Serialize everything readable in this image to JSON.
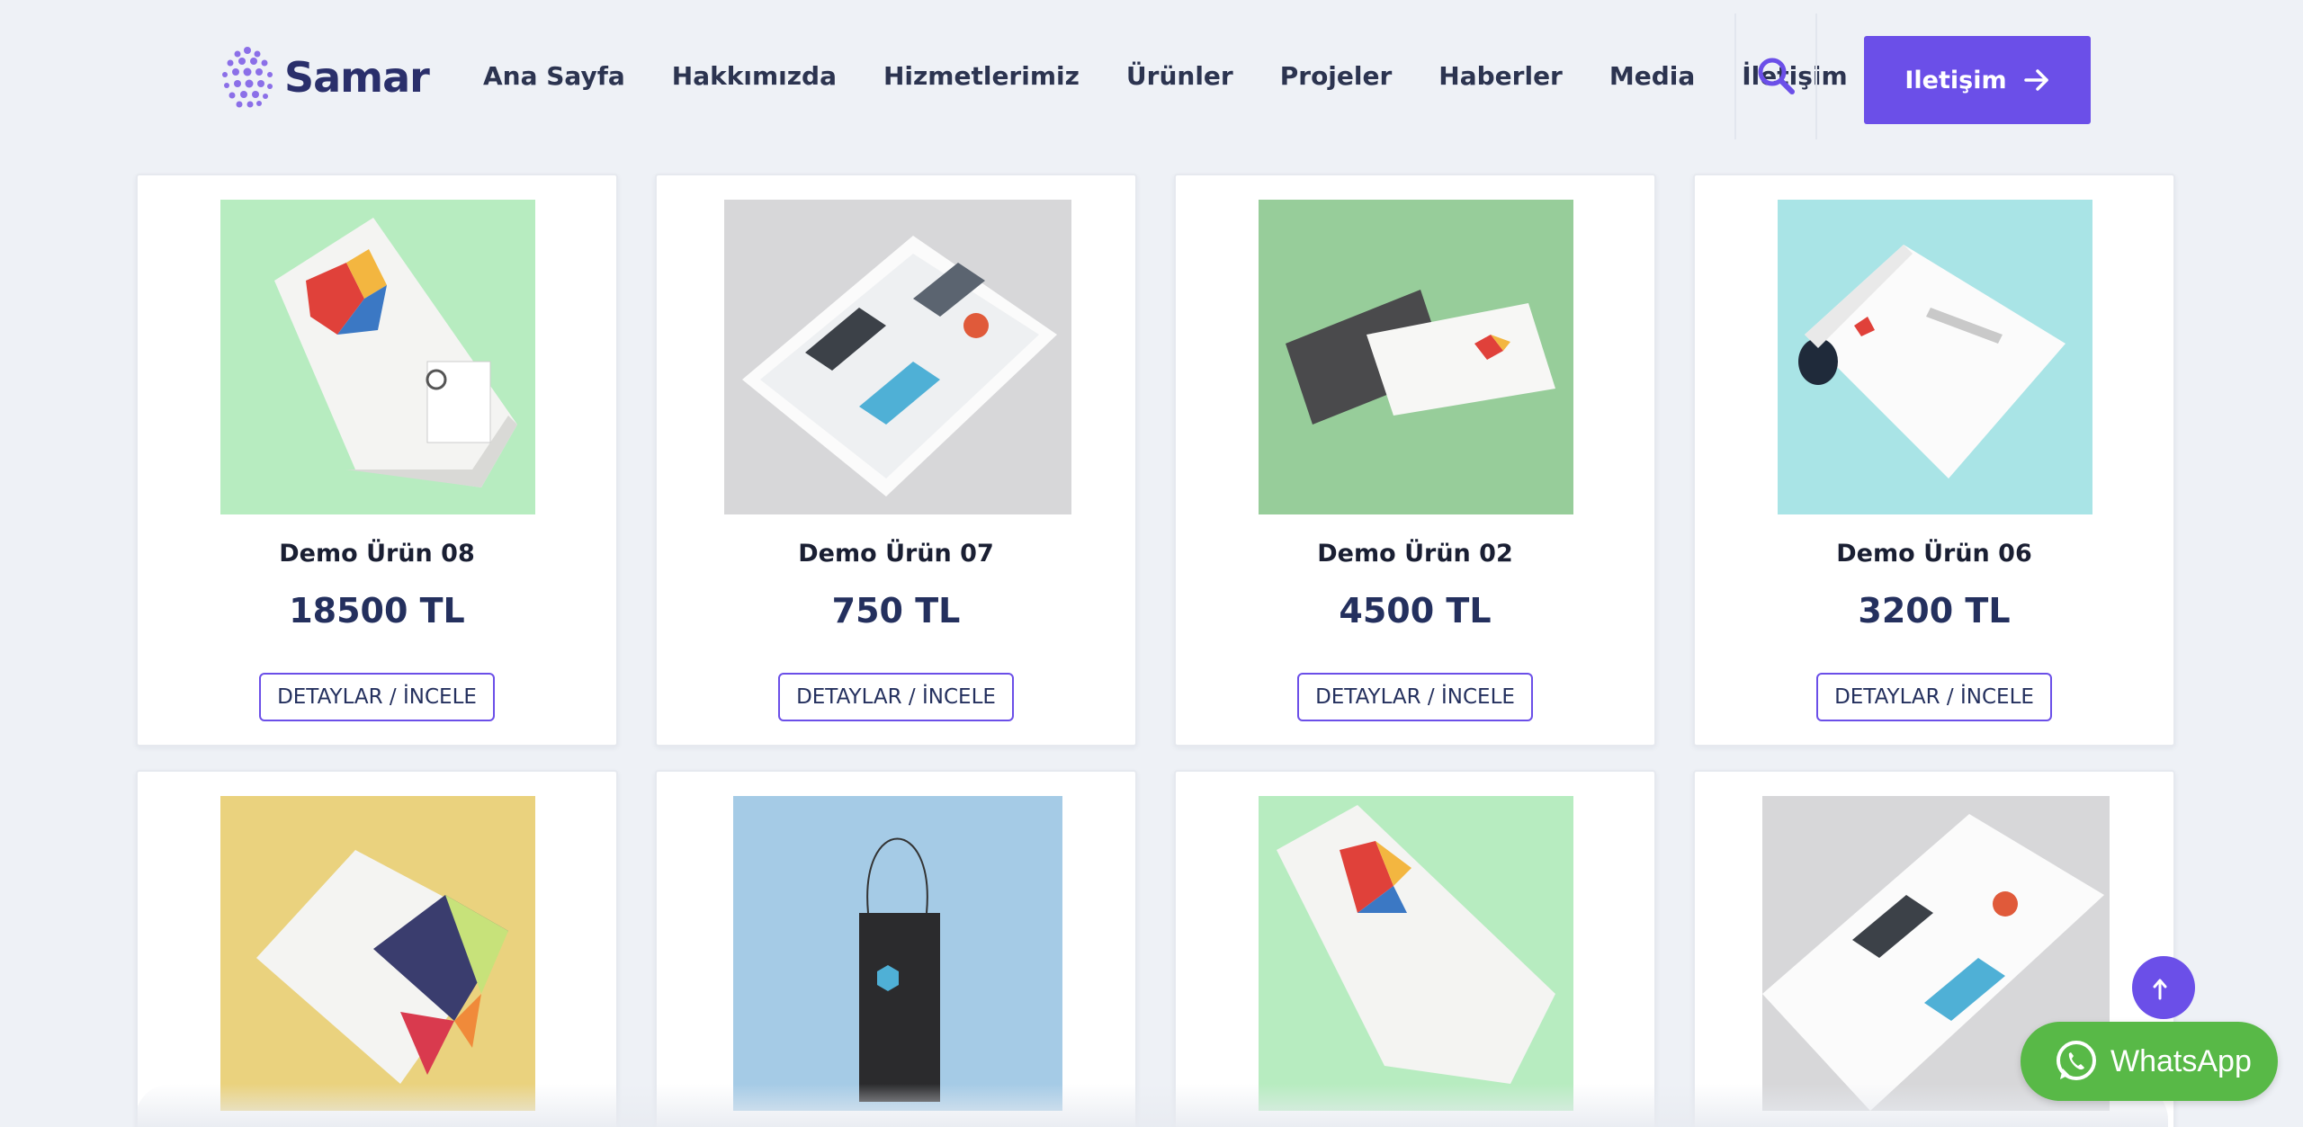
{
  "brand": {
    "name": "Samar",
    "accent": "#6b4fe8"
  },
  "nav": {
    "items": [
      {
        "label": "Ana Sayfa"
      },
      {
        "label": "Hakkımızda"
      },
      {
        "label": "Hizmetlerimiz"
      },
      {
        "label": "Ürünler"
      },
      {
        "label": "Projeler"
      },
      {
        "label": "Haberler"
      },
      {
        "label": "Media"
      },
      {
        "label": "İletişim"
      }
    ],
    "search_icon": "search-icon",
    "cta_label": "Iletişim",
    "cta_icon": "arrow-right-icon"
  },
  "products": [
    {
      "title": "Demo Ürün 08",
      "price": "18500 TL",
      "button": "DETAYLAR / İNCELE",
      "bg": "#b7ecc0"
    },
    {
      "title": "Demo Ürün 07",
      "price": "750 TL",
      "button": "DETAYLAR / İNCELE",
      "bg": "#d7d7d9"
    },
    {
      "title": "Demo Ürün 02",
      "price": "4500 TL",
      "button": "DETAYLAR / İNCELE",
      "bg": "#97cd9a"
    },
    {
      "title": "Demo Ürün 06",
      "price": "3200 TL",
      "button": "DETAYLAR / İNCELE",
      "bg": "#a9e4e6"
    },
    {
      "bg": "#ead27e"
    },
    {
      "bg": "#a5cbe6"
    },
    {
      "bg": "#b7ecc0"
    },
    {
      "bg": "#d7d7d9"
    }
  ],
  "floating": {
    "scroll_top_icon": "arrow-up-icon",
    "whatsapp_label": "WhatsApp",
    "whatsapp_color": "#58b947"
  }
}
